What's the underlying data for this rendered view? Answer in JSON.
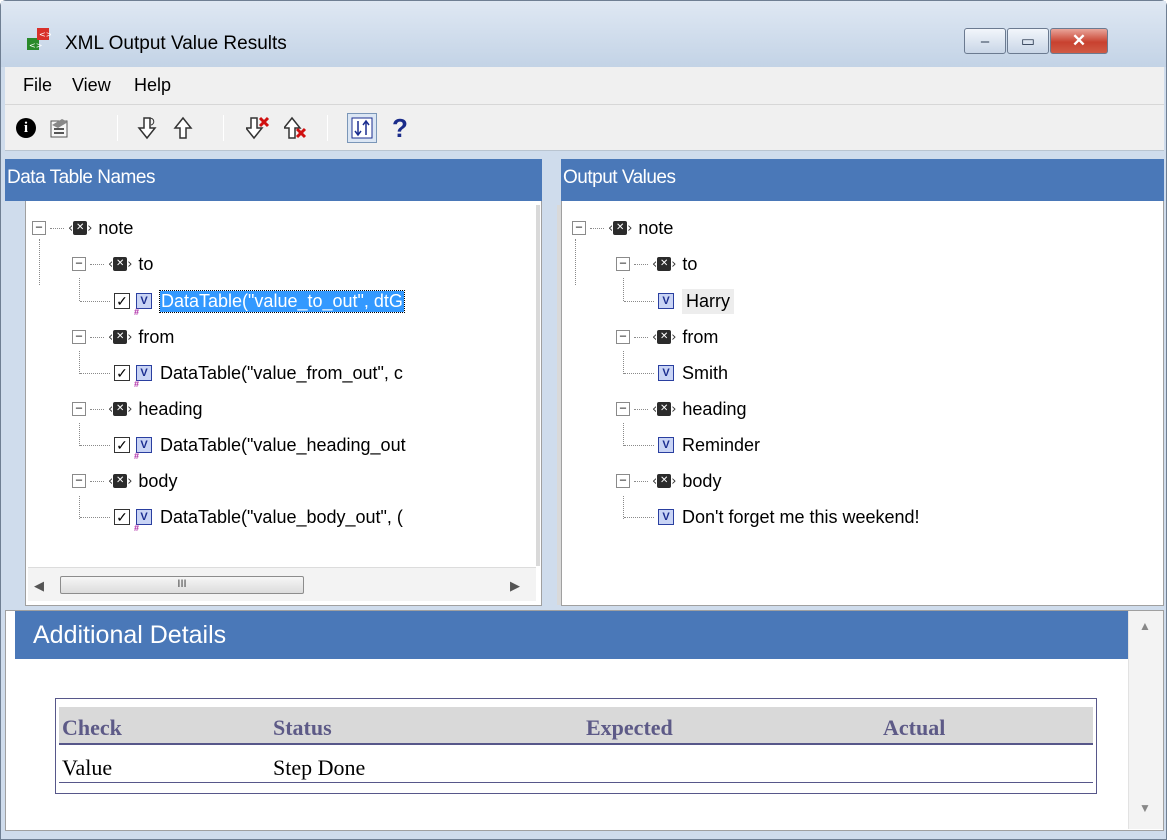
{
  "window": {
    "title": "XML Output Value Results",
    "app_icon": "xml-app-icon",
    "controls": {
      "minimize": "–",
      "maximize": "▭",
      "close": "✕"
    }
  },
  "menu": {
    "file": "File",
    "view": "View",
    "help": "Help"
  },
  "toolbar": {
    "items": [
      "info-icon",
      "properties-icon",
      "next-step-icon",
      "previous-step-icon",
      "next-error-icon",
      "previous-error-icon",
      "sort-icon",
      "help-icon"
    ],
    "help_label": "?"
  },
  "left_pane": {
    "header": "Data Table Names",
    "tree": {
      "root": "note",
      "children": [
        {
          "name": "to",
          "leaf": "DataTable(\"value_to_out\", dtG",
          "checked": true,
          "selected": true
        },
        {
          "name": "from",
          "leaf": "DataTable(\"value_from_out\", c",
          "checked": true
        },
        {
          "name": "heading",
          "leaf": "DataTable(\"value_heading_out",
          "checked": true
        },
        {
          "name": "body",
          "leaf": "DataTable(\"value_body_out\", (",
          "checked": true
        }
      ]
    },
    "hscroll_thumb": "III"
  },
  "right_pane": {
    "header": "Output Values",
    "tree": {
      "root": "note",
      "children": [
        {
          "name": "to",
          "leaf": "Harry"
        },
        {
          "name": "from",
          "leaf": "Smith"
        },
        {
          "name": "heading",
          "leaf": "Reminder"
        },
        {
          "name": "body",
          "leaf": "Don't forget me this weekend!"
        }
      ]
    }
  },
  "details": {
    "header": "Additional Details",
    "table": {
      "columns": [
        "Check",
        "Status",
        "Expected",
        "Actual"
      ],
      "rows": [
        [
          "Value",
          "Step Done",
          "",
          ""
        ]
      ]
    }
  },
  "colors": {
    "pane_header": "#4a78b8",
    "selection": "#3399ff",
    "table_header_text": "#5d5a87"
  }
}
